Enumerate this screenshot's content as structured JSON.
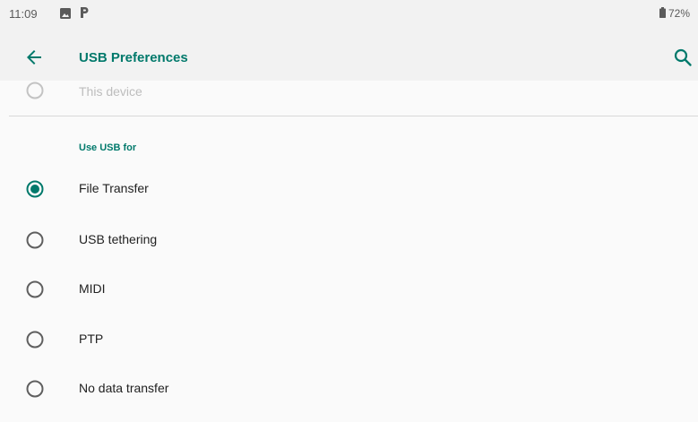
{
  "status_bar": {
    "time": "11:09",
    "battery": "72%",
    "icons": [
      "image-icon",
      "p-icon",
      "battery-icon"
    ]
  },
  "toolbar": {
    "title": "USB Preferences",
    "back_icon": "back-arrow-icon",
    "search_icon": "search-icon"
  },
  "previous_section": {
    "label": "This device"
  },
  "usb_section": {
    "header": "Use USB for",
    "options": [
      {
        "label": "File Transfer",
        "selected": true
      },
      {
        "label": "USB tethering",
        "selected": false
      },
      {
        "label": "MIDI",
        "selected": false
      },
      {
        "label": "PTP",
        "selected": false
      },
      {
        "label": "No data transfer",
        "selected": false
      }
    ]
  },
  "colors": {
    "accent": "#00796b",
    "radio_unselected": "#5f5f5f",
    "background": "#fafafa",
    "bar_background": "#f2f2f2"
  }
}
